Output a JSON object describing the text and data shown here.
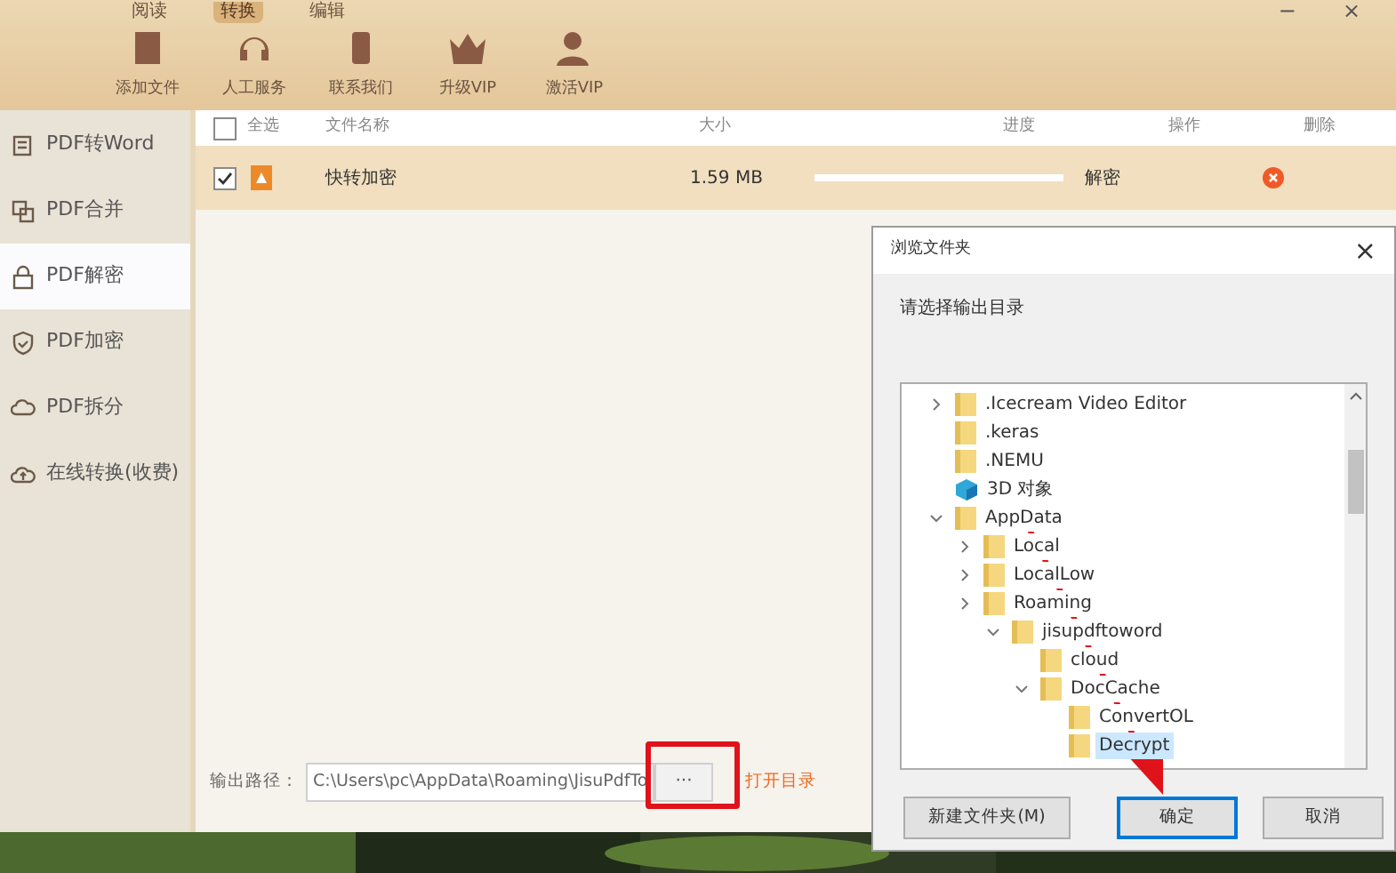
{
  "menu_tabs": [
    {
      "label": "阅读",
      "selected": false
    },
    {
      "label": "转换",
      "selected": true
    },
    {
      "label": "编辑",
      "selected": false
    }
  ],
  "toolbar": [
    {
      "label": "添加文件",
      "kind": "add"
    },
    {
      "label": "人工服务",
      "kind": "service"
    },
    {
      "label": "联系我们",
      "kind": "contact"
    },
    {
      "label": "升级VIP",
      "kind": "crown"
    },
    {
      "label": "激活VIP",
      "kind": "user"
    }
  ],
  "window_controls": [
    "−",
    "×"
  ],
  "sidebar": {
    "items": [
      {
        "label": "PDF转Word",
        "kind": "word",
        "selected": false
      },
      {
        "label": "PDF合并",
        "kind": "merge",
        "selected": false
      },
      {
        "label": "PDF解密",
        "kind": "lock",
        "selected": true
      },
      {
        "label": "PDF加密",
        "kind": "shield",
        "selected": false
      },
      {
        "label": "PDF拆分",
        "kind": "split",
        "selected": false
      },
      {
        "label": "在线转换(收费)",
        "kind": "cloud",
        "selected": false
      }
    ]
  },
  "table": {
    "select_all": {
      "label": "全选",
      "checked": false
    },
    "columns": [
      "文件名称",
      "大小",
      "进度",
      "操作",
      "删除"
    ],
    "rows": [
      {
        "checked": true,
        "name": "快转加密",
        "size": "1.59 MB",
        "level": 1,
        "action": "解密"
      }
    ]
  },
  "output": {
    "label": "输出路径：",
    "value": "C:\\Users\\pc\\AppData\\Roaming\\JisuPdfTo",
    "browse": "···",
    "open": "打开目录"
  },
  "dialog": {
    "title": "浏览文件夹",
    "close": "×",
    "prompt": "请选择输出目录",
    "tree": [
      {
        "label": ".Icecream Video Editor",
        "kind": "folder",
        "expanded": false,
        "selected": false
      },
      {
        "label": ".keras",
        "kind": "folder",
        "selected": false
      },
      {
        "label": ".NEMU",
        "kind": "folder",
        "selected": false
      },
      {
        "label": "3D 对象",
        "kind": "objects3d",
        "selected": false
      },
      {
        "label": "AppData",
        "kind": "folder",
        "expanded": true,
        "selected": false,
        "children": [
          {
            "label": "Local",
            "kind": "folder",
            "expanded": false,
            "selected": false
          },
          {
            "label": "LocalLow",
            "kind": "folder",
            "expanded": false,
            "selected": false
          },
          {
            "label": "Roaming",
            "kind": "folder",
            "expanded": false,
            "selected": false,
            "children": [
              {
                "label": "jisupdftoword",
                "kind": "folder",
                "expanded": true,
                "selected": false,
                "children": [
                  {
                    "label": "cloud",
                    "kind": "folder",
                    "selected": false
                  },
                  {
                    "label": "DocCache",
                    "kind": "folder",
                    "expanded": true,
                    "selected": false,
                    "children": [
                      {
                        "label": "ConvertOL",
                        "kind": "folder",
                        "selected": false
                      },
                      {
                        "label": "Decrypt",
                        "kind": "folder",
                        "selected": true
                      }
                    ]
                  }
                ]
              }
            ]
          }
        ]
      }
    ],
    "buttons": [
      {
        "label": "新建文件夹(M)",
        "default": false
      },
      {
        "label": "确定",
        "default": true
      },
      {
        "label": "取消",
        "default": false
      }
    ]
  }
}
